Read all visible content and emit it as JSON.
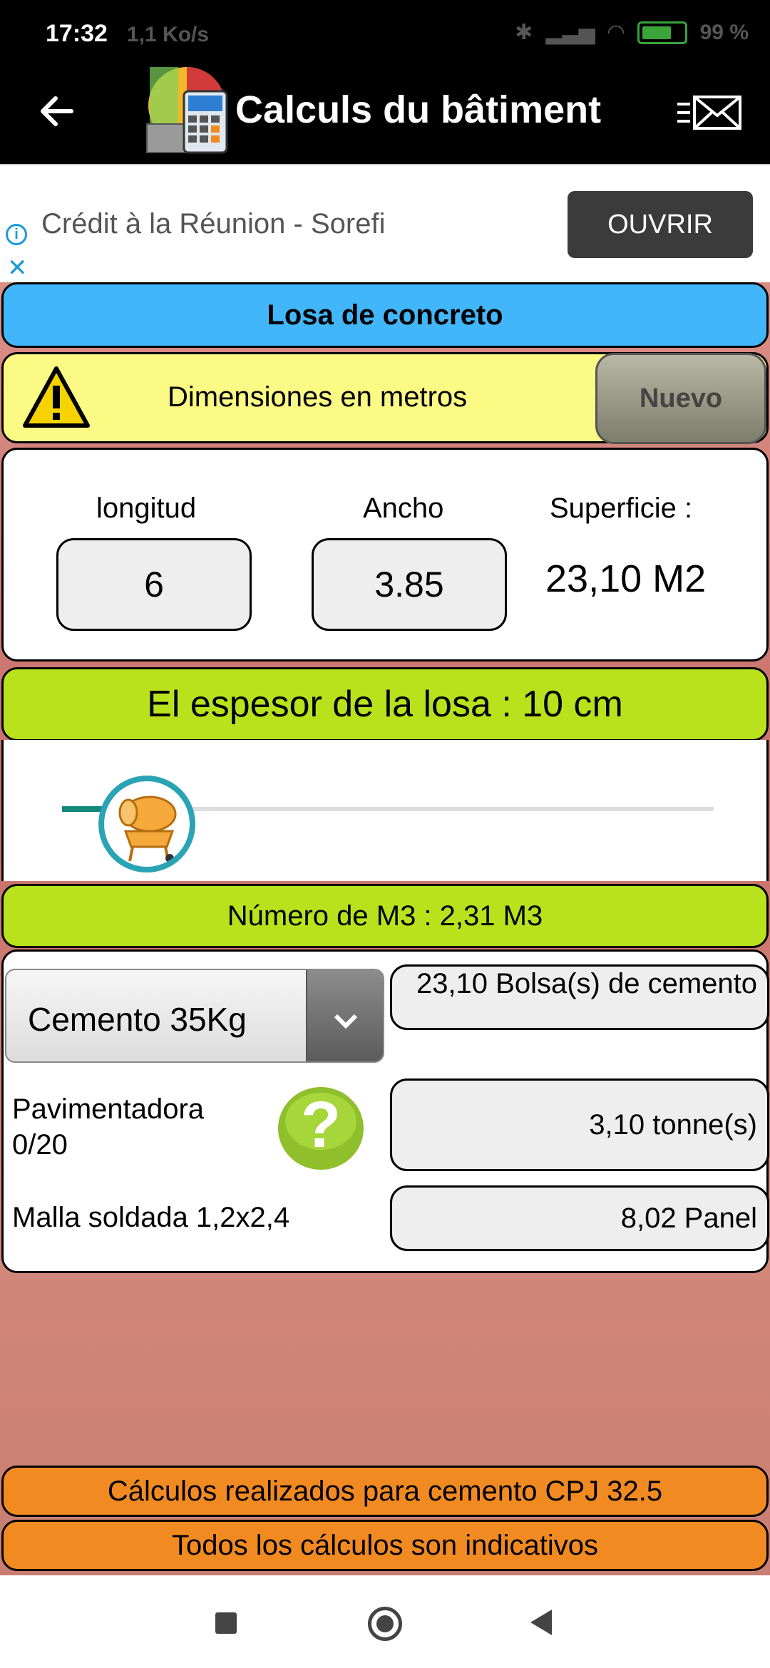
{
  "status_bar": {
    "time": "17:32",
    "speed": "1,1 Ko/s",
    "battery": "99 %"
  },
  "app_bar": {
    "title": "Calculs du bâtiment"
  },
  "ad": {
    "text": "Crédit à la Réunion - Sorefi",
    "button": "OUVRIR"
  },
  "header": {
    "title": "Losa de concreto"
  },
  "warning": {
    "label": "Dimensiones en metros",
    "new_button": "Nuevo"
  },
  "dimensions": {
    "length_label": "longitud",
    "length_value": "6",
    "width_label": "Ancho",
    "width_value": "3.85",
    "area_label": "Superficie :",
    "area_value": "23,10 M2"
  },
  "thickness": {
    "label": "El espesor de la losa : 10 cm",
    "slider_fraction": 0.13
  },
  "volume": {
    "label": "Número de M3 : 2,31 M3"
  },
  "results": {
    "cement_select": "Cemento 35Kg",
    "cement_result": "23,10 Bolsa(s) de cemento",
    "paver_label": "Pavimentadora 0/20",
    "paver_result": "3,10 tonne(s)",
    "mesh_label": "Malla soldada 1,2x2,4",
    "mesh_result": "8,02 Panel"
  },
  "footer": {
    "note1": "Cálculos realizados para cemento CPJ 32.5",
    "note2": "Todos los cálculos son indicativos"
  },
  "colors": {
    "blue": "#41b6fb",
    "yellow": "#fafa84",
    "green": "#b9e21c",
    "orange": "#f28a22"
  }
}
